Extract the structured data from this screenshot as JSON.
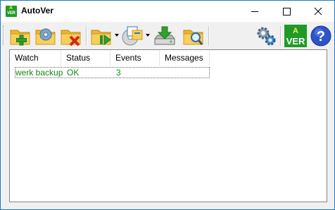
{
  "window": {
    "title": "AutoVer",
    "icon_text_top": "A",
    "icon_text_bottom": "VER"
  },
  "titlebar_controls": [
    "minimize-icon",
    "maximize-icon",
    "close-icon"
  ],
  "toolbar": {
    "buttons": [
      {
        "name": "add-watch",
        "icon": "folder-add-icon"
      },
      {
        "name": "edit-watch",
        "icon": "folder-edit-icon"
      },
      {
        "name": "delete-watch",
        "icon": "folder-delete-icon"
      },
      {
        "name": "run-watch",
        "icon": "folder-run-icon"
      },
      {
        "name": "view-versions",
        "icon": "versions-icon"
      },
      {
        "name": "restore",
        "icon": "restore-drive-icon"
      },
      {
        "name": "search",
        "icon": "folder-search-icon"
      },
      {
        "name": "settings",
        "icon": "gear-icon"
      },
      {
        "name": "about",
        "icon": "autover-logo-icon"
      },
      {
        "name": "help",
        "icon": "help-icon"
      }
    ],
    "logo_text_top": "A",
    "logo_text_bottom": "VER",
    "help_text": "?"
  },
  "list": {
    "columns": [
      "Watch",
      "Status",
      "Events",
      "Messages"
    ],
    "rows": [
      {
        "watch": "werk backup",
        "status": "OK",
        "events": "3",
        "messages": ""
      }
    ]
  },
  "colors": {
    "row_text": "#118a11",
    "titlebar_border": "#1979ca"
  }
}
